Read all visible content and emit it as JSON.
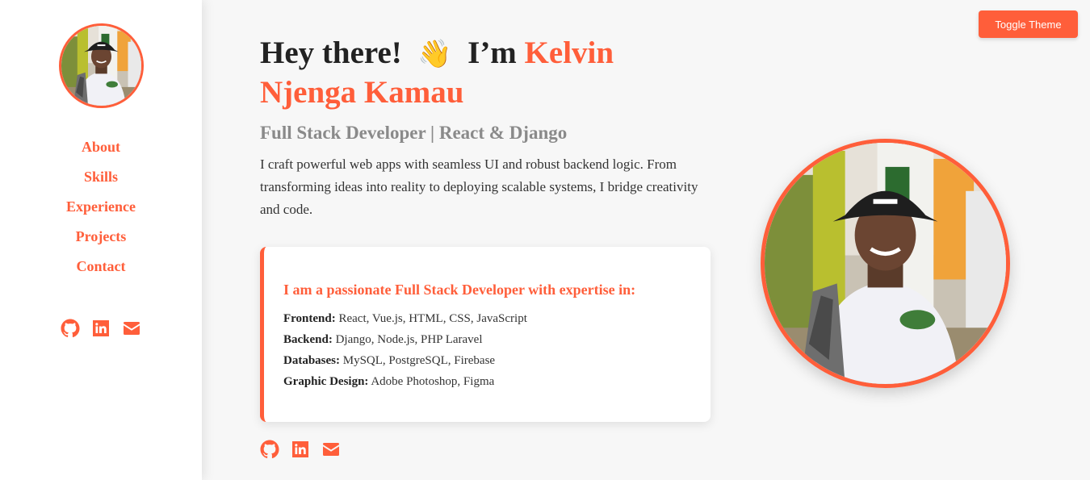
{
  "sidebar": {
    "nav": [
      "About",
      "Skills",
      "Experience",
      "Projects",
      "Contact"
    ],
    "social_icons": [
      "github-icon",
      "linkedin-icon",
      "envelope-icon"
    ]
  },
  "toggle_theme_label": "Toggle Theme",
  "hero": {
    "greeting": "Hey there!",
    "wave": "👋",
    "im": "I’m",
    "name": "Kelvin Njenga Kamau",
    "subtitle": "Full Stack Developer | React & Django",
    "intro": "I craft powerful web apps with seamless UI and robust backend logic. From transforming ideas into reality to deploying scalable systems, I bridge creativity and code."
  },
  "card": {
    "heading": "I am a passionate Full Stack Developer with expertise in:",
    "skills": [
      {
        "label": "Frontend:",
        "value": " React, Vue.js, HTML, CSS, JavaScript"
      },
      {
        "label": "Backend:",
        "value": " Django, Node.js, PHP Laravel"
      },
      {
        "label": "Databases:",
        "value": " MySQL, PostgreSQL, Firebase"
      },
      {
        "label": "Graphic Design:",
        "value": " Adobe Photoshop, Figma"
      }
    ]
  },
  "colors": {
    "accent": "#ff5e3a",
    "background": "#f7f7f7",
    "subtitle": "#8a8a8a"
  }
}
